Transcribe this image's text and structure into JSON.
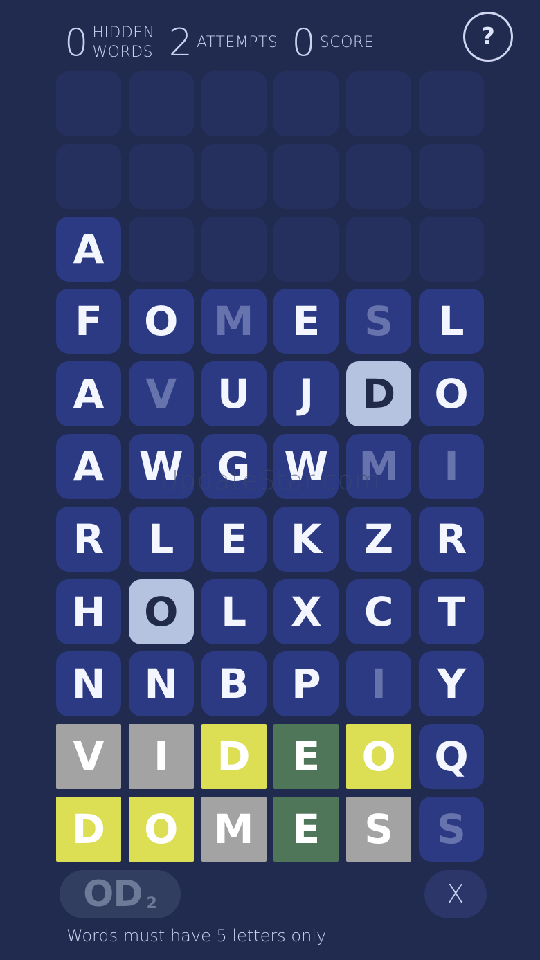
{
  "stats": [
    {
      "value": "0",
      "label": "HIDDEN WORDS"
    },
    {
      "value": "2",
      "label": "ATTEMPTS"
    },
    {
      "value": "0",
      "label": "SCORE"
    }
  ],
  "help_label": "?",
  "board": {
    "rows": [
      [
        {
          "letter": "",
          "state": "empty"
        },
        {
          "letter": "",
          "state": "empty"
        },
        {
          "letter": "",
          "state": "empty"
        },
        {
          "letter": "",
          "state": "empty"
        },
        {
          "letter": "",
          "state": "empty"
        },
        {
          "letter": "",
          "state": "empty"
        }
      ],
      [
        {
          "letter": "",
          "state": "empty"
        },
        {
          "letter": "",
          "state": "empty"
        },
        {
          "letter": "",
          "state": "empty"
        },
        {
          "letter": "",
          "state": "empty"
        },
        {
          "letter": "",
          "state": "empty"
        },
        {
          "letter": "",
          "state": "empty"
        }
      ],
      [
        {
          "letter": "A",
          "state": "blue"
        },
        {
          "letter": "",
          "state": "empty"
        },
        {
          "letter": "",
          "state": "empty"
        },
        {
          "letter": "",
          "state": "empty"
        },
        {
          "letter": "",
          "state": "empty"
        },
        {
          "letter": "",
          "state": "empty"
        }
      ],
      [
        {
          "letter": "F",
          "state": "blue"
        },
        {
          "letter": "O",
          "state": "blue"
        },
        {
          "letter": "M",
          "state": "dim"
        },
        {
          "letter": "E",
          "state": "blue"
        },
        {
          "letter": "S",
          "state": "dim"
        },
        {
          "letter": "L",
          "state": "blue"
        }
      ],
      [
        {
          "letter": "A",
          "state": "blue"
        },
        {
          "letter": "V",
          "state": "dim"
        },
        {
          "letter": "U",
          "state": "blue"
        },
        {
          "letter": "J",
          "state": "blue"
        },
        {
          "letter": "D",
          "state": "selected"
        },
        {
          "letter": "O",
          "state": "blue"
        }
      ],
      [
        {
          "letter": "A",
          "state": "blue"
        },
        {
          "letter": "W",
          "state": "blue"
        },
        {
          "letter": "G",
          "state": "blue"
        },
        {
          "letter": "W",
          "state": "blue"
        },
        {
          "letter": "M",
          "state": "dim"
        },
        {
          "letter": "I",
          "state": "dim"
        }
      ],
      [
        {
          "letter": "R",
          "state": "blue"
        },
        {
          "letter": "L",
          "state": "blue"
        },
        {
          "letter": "E",
          "state": "blue"
        },
        {
          "letter": "K",
          "state": "blue"
        },
        {
          "letter": "Z",
          "state": "blue"
        },
        {
          "letter": "R",
          "state": "blue"
        }
      ],
      [
        {
          "letter": "H",
          "state": "blue"
        },
        {
          "letter": "O",
          "state": "selected"
        },
        {
          "letter": "L",
          "state": "blue"
        },
        {
          "letter": "X",
          "state": "blue"
        },
        {
          "letter": "C",
          "state": "blue"
        },
        {
          "letter": "T",
          "state": "blue"
        }
      ],
      [
        {
          "letter": "N",
          "state": "blue"
        },
        {
          "letter": "N",
          "state": "blue"
        },
        {
          "letter": "B",
          "state": "blue"
        },
        {
          "letter": "P",
          "state": "blue"
        },
        {
          "letter": "I",
          "state": "dim"
        },
        {
          "letter": "Y",
          "state": "blue"
        }
      ],
      [
        {
          "letter": "V",
          "state": "gray"
        },
        {
          "letter": "I",
          "state": "gray"
        },
        {
          "letter": "D",
          "state": "yellow"
        },
        {
          "letter": "E",
          "state": "green"
        },
        {
          "letter": "O",
          "state": "yellow"
        },
        {
          "letter": "Q",
          "state": "blue"
        }
      ],
      [
        {
          "letter": "D",
          "state": "yellow"
        },
        {
          "letter": "O",
          "state": "yellow"
        },
        {
          "letter": "M",
          "state": "gray"
        },
        {
          "letter": "E",
          "state": "green"
        },
        {
          "letter": "S",
          "state": "gray"
        },
        {
          "letter": "S",
          "state": "dim"
        }
      ]
    ]
  },
  "watermark": "UpdateStar.com",
  "current_word": {
    "text": "OD",
    "count": "2"
  },
  "clear_label": "X",
  "hint": "Words must have 5 letters only",
  "colors": {
    "background": "#212a4f",
    "tile_blue": "#2b3a82",
    "tile_selected": "#b6c3e0",
    "tile_gray": "#a3a3a3",
    "tile_yellow": "#dcde54",
    "tile_green": "#50765a"
  }
}
